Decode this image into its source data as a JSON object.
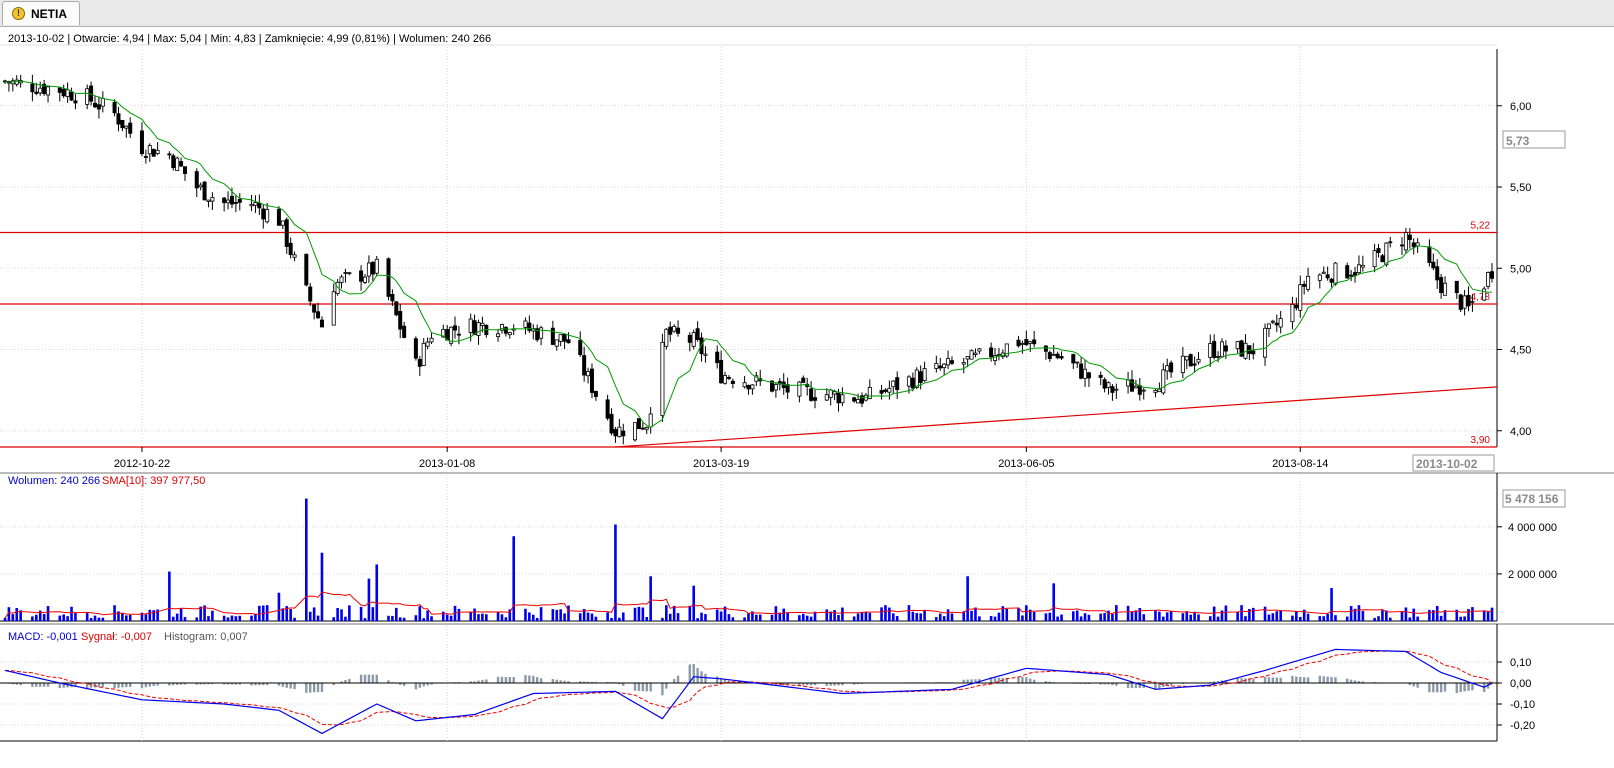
{
  "tab": {
    "label": "NETIA",
    "icon": "warning-icon"
  },
  "price_panel": {
    "info": {
      "date": "2013-10-02",
      "open": "Otwarcie: 4,94",
      "max": "Max: 5,04",
      "min": "Min: 4,83",
      "close": "Zamknięcie: 4,99 (0,81%)",
      "volume": "Wolumen: 240 266"
    },
    "cursor_price": "5,73",
    "cursor_date": "2013-10-02",
    "y_ticks": [
      "6,00",
      "5,50",
      "5,00",
      "4,50",
      "4,00"
    ],
    "x_ticks": [
      "2012-10-22",
      "2013-01-08",
      "2013-03-19",
      "2013-06-05",
      "2013-08-14"
    ],
    "lines": [
      {
        "label": "5,22",
        "value": 5.22
      },
      {
        "label": "4,78",
        "value": 4.78
      },
      {
        "label": "3,90",
        "value": 3.9
      }
    ]
  },
  "volume_panel": {
    "label": "Wolumen: 240 266",
    "sma_label": "SMA[10]: 397 977,50",
    "cursor_value": "5 478 156",
    "y_ticks": [
      "4 000 000",
      "2 000 000"
    ]
  },
  "macd_panel": {
    "macd_label": "MACD: -0,001",
    "signal_label": "Sygnał: -0,007",
    "hist_label": "Histogram: 0,007",
    "y_ticks": [
      "0,10",
      "0,00",
      "-0,10",
      "-0,20"
    ]
  },
  "colors": {
    "up": "#ffffff",
    "down": "#000000",
    "ma": "#009900",
    "level": "#e00000",
    "volume": "#0000ee",
    "sma": "#ee0000",
    "macd": "#0000ee",
    "signal": "#ee0000",
    "hist": "#8a9aa6"
  },
  "chart_data": [
    {
      "type": "candlestick",
      "title": "NETIA",
      "x_range": [
        "2012-09-17",
        "2013-10-02"
      ],
      "ylim": [
        3.9,
        6.3
      ],
      "anchors_close": [
        [
          "2012-09-17",
          6.15
        ],
        [
          "2012-10-01",
          6.1
        ],
        [
          "2012-10-08",
          6.05
        ],
        [
          "2012-10-15",
          5.95
        ],
        [
          "2012-10-22",
          5.75
        ],
        [
          "2012-10-29",
          5.7
        ],
        [
          "2012-11-05",
          5.5
        ],
        [
          "2012-11-12",
          5.4
        ],
        [
          "2012-11-19",
          5.4
        ],
        [
          "2012-11-26",
          5.3
        ],
        [
          "2012-12-03",
          4.85
        ],
        [
          "2012-12-07",
          4.65
        ],
        [
          "2012-12-10",
          4.9
        ],
        [
          "2012-12-21",
          5.0
        ],
        [
          "2012-12-31",
          4.4
        ],
        [
          "2013-01-04",
          4.6
        ],
        [
          "2013-01-15",
          4.65
        ],
        [
          "2013-01-25",
          4.65
        ],
        [
          "2013-02-08",
          4.55
        ],
        [
          "2013-02-20",
          4.0
        ],
        [
          "2013-02-28",
          4.05
        ],
        [
          "2013-03-05",
          4.6
        ],
        [
          "2013-03-12",
          4.55
        ],
        [
          "2013-03-19",
          4.35
        ],
        [
          "2013-04-05",
          4.25
        ],
        [
          "2013-04-25",
          4.2
        ],
        [
          "2013-05-10",
          4.35
        ],
        [
          "2013-05-24",
          4.45
        ],
        [
          "2013-06-03",
          4.55
        ],
        [
          "2013-06-14",
          4.45
        ],
        [
          "2013-06-26",
          4.25
        ],
        [
          "2013-07-08",
          4.3
        ],
        [
          "2013-07-22",
          4.5
        ],
        [
          "2013-08-02",
          4.5
        ],
        [
          "2013-08-12",
          4.75
        ],
        [
          "2013-08-16",
          4.95
        ],
        [
          "2013-08-30",
          5.0
        ],
        [
          "2013-09-10",
          5.2
        ],
        [
          "2013-09-19",
          4.9
        ],
        [
          "2013-09-26",
          4.75
        ],
        [
          "2013-10-02",
          4.99
        ]
      ],
      "trendline": {
        "from": [
          "2013-02-20",
          3.9
        ],
        "to": [
          "2013-10-02",
          4.27
        ]
      }
    },
    {
      "type": "bar",
      "title": "Wolumen",
      "ylim": [
        0,
        5478156
      ],
      "base": 400000,
      "spikes": [
        [
          "2012-10-29",
          2100000
        ],
        [
          "2012-11-26",
          1200000
        ],
        [
          "2012-12-03",
          5200000
        ],
        [
          "2012-12-07",
          2900000
        ],
        [
          "2012-12-19",
          1800000
        ],
        [
          "2012-12-21",
          2400000
        ],
        [
          "2013-01-25",
          3600000
        ],
        [
          "2013-01-27",
          1900000
        ],
        [
          "2013-02-20",
          4100000
        ],
        [
          "2013-03-01",
          1900000
        ],
        [
          "2013-03-12",
          1500000
        ],
        [
          "2013-05-21",
          1900000
        ],
        [
          "2013-06-01",
          2100000
        ],
        [
          "2013-06-12",
          1600000
        ],
        [
          "2013-08-22",
          1400000
        ],
        [
          "2013-09-14",
          2000000
        ]
      ]
    },
    {
      "type": "line",
      "title": "MACD",
      "ylim": [
        -0.25,
        0.18
      ],
      "macd_anchors": [
        [
          "2012-09-17",
          0.06
        ],
        [
          "2012-10-01",
          0.0
        ],
        [
          "2012-10-22",
          -0.08
        ],
        [
          "2012-11-12",
          -0.1
        ],
        [
          "2012-11-26",
          -0.13
        ],
        [
          "2012-12-07",
          -0.24
        ],
        [
          "2012-12-21",
          -0.1
        ],
        [
          "2012-12-31",
          -0.18
        ],
        [
          "2013-01-15",
          -0.15
        ],
        [
          "2013-01-30",
          -0.05
        ],
        [
          "2013-02-20",
          -0.04
        ],
        [
          "2013-03-04",
          -0.17
        ],
        [
          "2013-03-12",
          0.03
        ],
        [
          "2013-03-19",
          0.02
        ],
        [
          "2013-04-19",
          -0.05
        ],
        [
          "2013-05-17",
          -0.03
        ],
        [
          "2013-06-05",
          0.07
        ],
        [
          "2013-06-26",
          0.04
        ],
        [
          "2013-07-08",
          -0.03
        ],
        [
          "2013-07-22",
          -0.01
        ],
        [
          "2013-08-05",
          0.06
        ],
        [
          "2013-08-23",
          0.16
        ],
        [
          "2013-09-10",
          0.15
        ],
        [
          "2013-09-19",
          0.05
        ],
        [
          "2013-09-30",
          -0.02
        ],
        [
          "2013-10-02",
          -0.001
        ]
      ],
      "signal_last": -0.007,
      "histogram_last": 0.007
    }
  ]
}
